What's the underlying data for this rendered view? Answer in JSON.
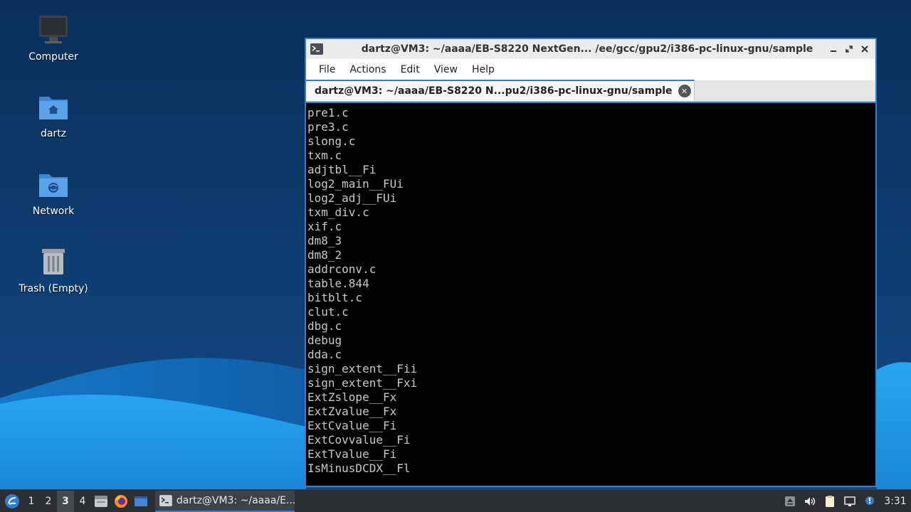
{
  "desktop": {
    "icons": [
      {
        "label": "Computer",
        "icon": "computer-icon"
      },
      {
        "label": "dartz",
        "icon": "home-folder-icon"
      },
      {
        "label": "Network",
        "icon": "network-folder-icon"
      },
      {
        "label": "Trash (Empty)",
        "icon": "trash-icon"
      }
    ]
  },
  "window": {
    "title": "dartz@VM3: ~/aaaa/EB-S8220 NextGen... /ee/gcc/gpu2/i386-pc-linux-gnu/sample",
    "menu": [
      "File",
      "Actions",
      "Edit",
      "View",
      "Help"
    ],
    "tab_title": "dartz@VM3: ~/aaaa/EB-S8220 N...pu2/i386-pc-linux-gnu/sample",
    "terminal_lines": [
      "pre1.c",
      "pre3.c",
      "slong.c",
      "txm.c",
      "adjtbl__Fi",
      "log2_main__FUi",
      "log2_adj__FUi",
      "txm_div.c",
      "xif.c",
      "dm8_3",
      "dm8_2",
      "addrconv.c",
      "table.844",
      "bitblt.c",
      "clut.c",
      "dbg.c",
      "debug",
      "dda.c",
      "sign_extent__Fii",
      "sign_extent__Fxi",
      "ExtZslope__Fx",
      "ExtZvalue__Fx",
      "ExtCvalue__Fi",
      "ExtCovvalue__Fi",
      "ExtTvalue__Fi",
      "IsMinusDCDX__Fl"
    ]
  },
  "taskbar": {
    "workspaces": [
      "1",
      "2",
      "3",
      "4"
    ],
    "active_workspace": "3",
    "task_label": "dartz@VM3: ~/aaaa/E...",
    "clock": "3:31"
  },
  "colors": {
    "accent": "#2e7fd0",
    "desktop_dark": "#0d3a6b",
    "wave_light": "#1e9be8"
  }
}
